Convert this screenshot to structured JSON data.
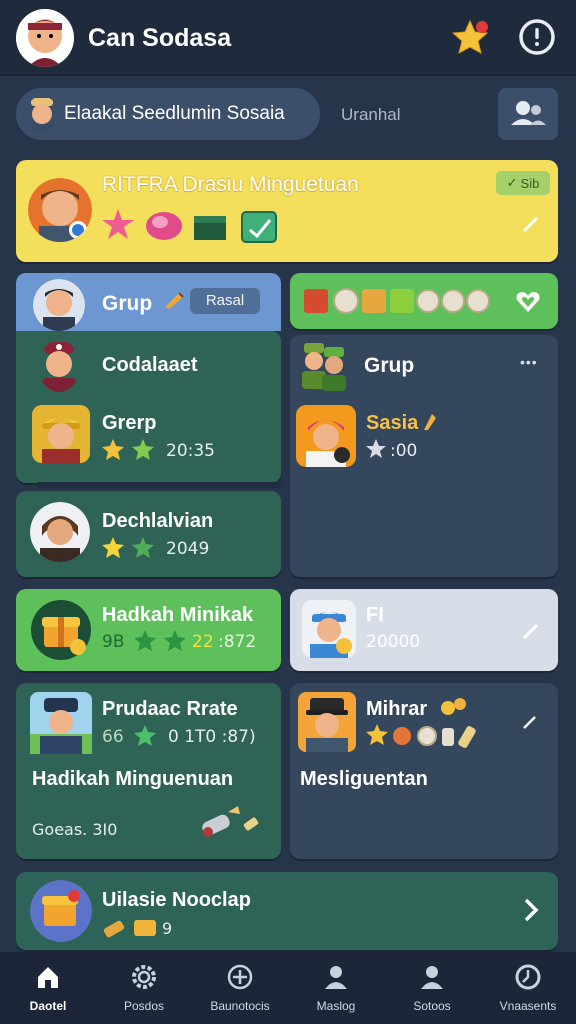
{
  "app": {
    "title": "Can Sodasa"
  },
  "search": {
    "left_label": "Elaakal Seedlumin Sosaia",
    "right_label": "Uranhal"
  },
  "featured": {
    "title": "RITFRA Drasiu Minguetuan",
    "badge": "Sib"
  },
  "grup_header": {
    "title": "Grup",
    "tag": "Rasal"
  },
  "left_group": {
    "header_title": "Codalaaet",
    "rows": [
      {
        "name": "Grerp",
        "score": "20:35"
      },
      {
        "name": "Dechlalvian",
        "score": "2049"
      }
    ]
  },
  "right_group": {
    "title": "Grup",
    "menu": "•••",
    "name": "Sasia",
    "score": ":00"
  },
  "hadikah": {
    "title": "Hadkah Minikak",
    "left": "9B",
    "highlight": "22",
    "score": ":872"
  },
  "fi_card": {
    "title": "FI",
    "score": "20000"
  },
  "produce": {
    "title": "Prudaac Rrate",
    "left": "66",
    "range": "0 1T0 :87)",
    "subtitle": "Hadikah Minguenuan",
    "footer": "Goeas. 3I0"
  },
  "mihrar": {
    "title": "Mihrar",
    "subtitle": "Mesliguentan"
  },
  "bottom_banner": {
    "title": "Uilasie Nooclap",
    "count": "9"
  },
  "nav": [
    {
      "label": "Daotel",
      "icon": "home-icon"
    },
    {
      "label": "Posdos",
      "icon": "gear-icon"
    },
    {
      "label": "Baunotocis",
      "icon": "add-icon"
    },
    {
      "label": "Maslog",
      "icon": "profile-icon"
    },
    {
      "label": "Sotoos",
      "icon": "user-icon"
    },
    {
      "label": "Vnaasents",
      "icon": "clock-icon"
    }
  ],
  "colors": {
    "background": "#27354a",
    "card_green": "#2f6356",
    "card_slate": "#34475c",
    "yellow_banner": "#f4df5c",
    "blue_tab": "#6d97d1",
    "bright_green": "#5dc05a",
    "accent_yellow": "#f4c23a",
    "accent_green": "#4ac06a"
  }
}
